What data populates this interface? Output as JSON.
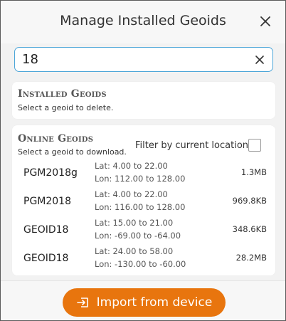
{
  "dialog": {
    "title": "Manage Installed Geoids",
    "close_icon": "close-icon"
  },
  "search": {
    "value": "18",
    "clear_icon": "clear-icon"
  },
  "installed": {
    "title": "Installed Geoids",
    "subtitle": "Select a geoid to delete."
  },
  "online": {
    "title": "Online Geoids",
    "subtitle": "Select a geoid to download.",
    "filter_label": "Filter by current location",
    "filter_checked": false,
    "rows": [
      {
        "name": "PGM2018g",
        "lat": "Lat: 4.00 to 22.00",
        "lon": "Lon: 112.00 to 128.00",
        "size": "1.3MB"
      },
      {
        "name": "PGM2018",
        "lat": "Lat: 4.00 to 22.00",
        "lon": "Lon: 116.00 to 128.00",
        "size": "969.8KB"
      },
      {
        "name": "GEOID18",
        "lat": "Lat: 15.00 to 21.00",
        "lon": "Lon: -69.00 to -64.00",
        "size": "348.6KB"
      },
      {
        "name": "GEOID18",
        "lat": "Lat: 24.00 to 58.00",
        "lon": "Lon: -130.00 to -60.00",
        "size": "28.2MB"
      }
    ]
  },
  "footer": {
    "import_label": "Import from device",
    "import_icon": "import-icon",
    "accent_color": "#e8750e"
  }
}
